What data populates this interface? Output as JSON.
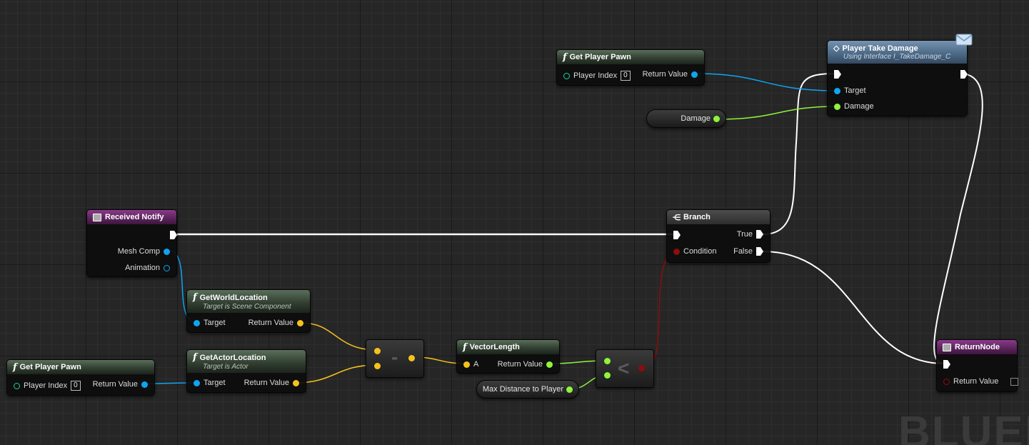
{
  "graph": {
    "watermark": "BLUEPI",
    "colors": {
      "exec_wire": "#ffffff",
      "object_pin": "#0ea5f0",
      "float_pin": "#8ff53b",
      "vector_pin": "#f5c21c",
      "bool_pin": "#8c0d0d",
      "int_pin": "#1dd0a0"
    }
  },
  "nodes": {
    "get_player_pawn_top": {
      "title": "Get Player Pawn",
      "player_index_label": "Player Index",
      "player_index_value": "0",
      "return_label": "Return Value"
    },
    "player_take_damage": {
      "title": "Player Take Damage",
      "subtitle": "Using Interface I_TakeDamage_C",
      "target_label": "Target",
      "damage_label": "Damage"
    },
    "damage_var": {
      "label": "Damage"
    },
    "received_notify": {
      "title": "Received Notify",
      "mesh_comp_label": "Mesh Comp",
      "animation_label": "Animation"
    },
    "branch": {
      "title": "Branch",
      "condition_label": "Condition",
      "true_label": "True",
      "false_label": "False"
    },
    "get_world_location": {
      "title": "GetWorldLocation",
      "subtitle": "Target is Scene Component",
      "target_label": "Target",
      "return_label": "Return Value"
    },
    "get_actor_location": {
      "title": "GetActorLocation",
      "subtitle": "Target is Actor",
      "target_label": "Target",
      "return_label": "Return Value"
    },
    "get_player_pawn_bottom": {
      "title": "Get Player Pawn",
      "player_index_label": "Player Index",
      "player_index_value": "0",
      "return_label": "Return Value"
    },
    "subtract": {
      "symbol": "-"
    },
    "vector_length": {
      "title": "VectorLength",
      "a_label": "A",
      "return_label": "Return Value"
    },
    "max_distance_var": {
      "label": "Max Distance to Player"
    },
    "less_than": {
      "symbol": "<"
    },
    "return_node": {
      "title": "ReturnNode",
      "return_label": "Return Value"
    }
  }
}
